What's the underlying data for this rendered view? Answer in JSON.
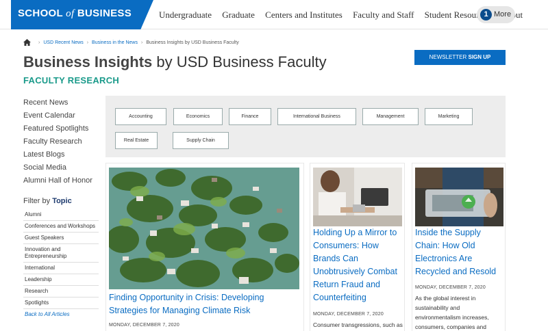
{
  "header": {
    "logo": {
      "part1": "SCHOOL ",
      "of": "of",
      "part2": " BUSINESS"
    },
    "nav": [
      "Undergraduate",
      "Graduate",
      "Centers and Institutes",
      "Faculty and Staff",
      "Student Resources",
      "About"
    ],
    "more": {
      "badge": "1",
      "label": "More"
    }
  },
  "breadcrumb": {
    "items": [
      "USD Recent News",
      "Business in the News"
    ],
    "current": "Business Insights by USD Business Faculty"
  },
  "page": {
    "title_bold": "Business Insights",
    "title_rest": " by USD Business Faculty",
    "subtitle": "FACULTY RESEARCH",
    "newsletter_normal": "NEWSLETTER ",
    "newsletter_bold": "SIGN UP"
  },
  "sidebar": {
    "links": [
      "Recent News",
      "Event Calendar",
      "Featured Spotlights",
      "Faculty Research",
      "Latest Blogs",
      "Social Media",
      "Alumni Hall of Honor"
    ],
    "filter_prefix": "Filter by ",
    "filter_bold": "Topic",
    "topics": [
      "Alumni",
      "Conferences and Workshops",
      "Guest Speakers",
      "Innovation and Entrepreneurship",
      "International",
      "Leadership",
      "Research",
      "Spotlights"
    ],
    "back": "Back to All Articles"
  },
  "tags": [
    "Accounting",
    "Economics",
    "Finance",
    "International Business",
    "Management",
    "Marketing",
    "Real Estate",
    "Supply Chain"
  ],
  "cards": [
    {
      "title": "Finding Opportunity in Crisis: Developing Strategies for Managing Climate Risk",
      "date": "MONDAY, DECEMBER 7, 2020",
      "text": ""
    },
    {
      "title": "Holding Up a Mirror to Consumers: How Brands Can Unobtrusively Combat Return Fraud and Counterfeiting",
      "date": "MONDAY, DECEMBER 7, 2020",
      "text": "Consumer transgressions, such as"
    },
    {
      "title": "Inside the Supply Chain: How Old Electronics Are Recycled and Resold",
      "date": "MONDAY, DECEMBER 7, 2020",
      "text": "As the global interest in sustainability and environmentalism increases, consumers, companies and"
    }
  ],
  "colors": {
    "brand_blue": "#0a6cc2",
    "teal": "#1a9a8a",
    "navy": "#0b4c8c"
  }
}
